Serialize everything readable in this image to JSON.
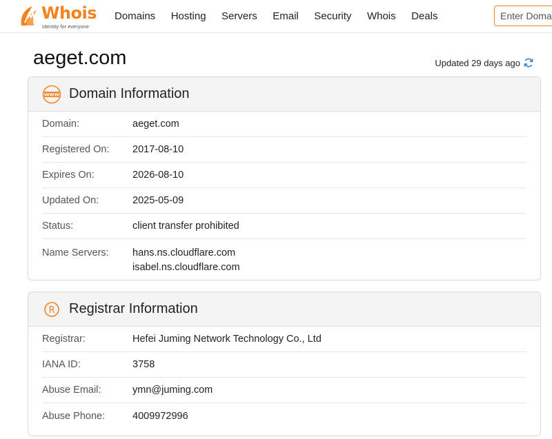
{
  "brand": {
    "name": "Whois",
    "tagline": "Identity for everyone",
    "accent": "#f58220"
  },
  "nav": {
    "items": [
      "Domains",
      "Hosting",
      "Servers",
      "Email",
      "Security",
      "Whois",
      "Deals"
    ]
  },
  "search": {
    "placeholder": "Enter Domain or IP"
  },
  "page": {
    "title": "aeget.com",
    "updated_text": "Updated 29 days ago",
    "refresh_icon": "refresh-icon"
  },
  "domain_info": {
    "heading": "Domain Information",
    "icon": "www-icon",
    "rows": [
      {
        "label": "Domain:",
        "value": "aeget.com"
      },
      {
        "label": "Registered On:",
        "value": "2017-08-10"
      },
      {
        "label": "Expires On:",
        "value": "2026-08-10"
      },
      {
        "label": "Updated On:",
        "value": "2025-05-09"
      },
      {
        "label": "Status:",
        "value": "client transfer prohibited"
      }
    ],
    "name_servers": {
      "label": "Name Servers:",
      "values": [
        "hans.ns.cloudflare.com",
        "isabel.ns.cloudflare.com"
      ]
    }
  },
  "registrar_info": {
    "heading": "Registrar Information",
    "icon": "registered-icon",
    "rows": [
      {
        "label": "Registrar:",
        "value": "Hefei Juming Network Technology Co., Ltd"
      },
      {
        "label": "IANA ID:",
        "value": "3758"
      },
      {
        "label": "Abuse Email:",
        "value": "ymn@juming.com"
      },
      {
        "label": "Abuse Phone:",
        "value": "4009972996"
      }
    ]
  }
}
